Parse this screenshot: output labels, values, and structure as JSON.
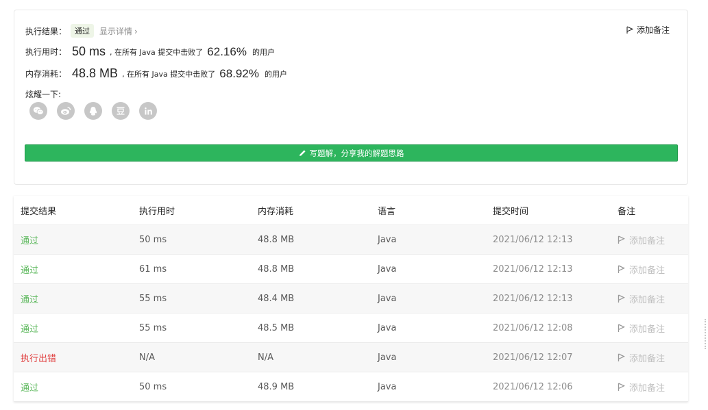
{
  "result": {
    "label_status": "执行结果：",
    "status": "通过",
    "details_link": "显示详情",
    "add_note": "添加备注",
    "runtime": {
      "label": "执行用时：",
      "value": "50 ms",
      "prefix": ", 在所有 Java 提交中击败了",
      "percent": "62.16%",
      "suffix": "的用户"
    },
    "memory": {
      "label": "内存消耗：",
      "value": "48.8 MB",
      "prefix": ", 在所有 Java 提交中击败了",
      "percent": "68.92%",
      "suffix": "的用户"
    },
    "share_label": "炫耀一下:",
    "share_icons": [
      "wechat-icon",
      "weibo-icon",
      "qq-icon",
      "douban-icon",
      "linkedin-icon"
    ],
    "write_solution": "写题解，分享我的解题思路"
  },
  "table": {
    "headers": [
      "提交结果",
      "执行用时",
      "内存消耗",
      "语言",
      "提交时间",
      "备注"
    ],
    "rows": [
      {
        "status": "通过",
        "ok": true,
        "time": "50 ms",
        "memory": "48.8 MB",
        "lang": "Java",
        "submitted": "2021/06/12 12:13",
        "note": "添加备注"
      },
      {
        "status": "通过",
        "ok": true,
        "time": "61 ms",
        "memory": "48.8 MB",
        "lang": "Java",
        "submitted": "2021/06/12 12:13",
        "note": "添加备注"
      },
      {
        "status": "通过",
        "ok": true,
        "time": "55 ms",
        "memory": "48.4 MB",
        "lang": "Java",
        "submitted": "2021/06/12 12:13",
        "note": "添加备注"
      },
      {
        "status": "通过",
        "ok": true,
        "time": "55 ms",
        "memory": "48.5 MB",
        "lang": "Java",
        "submitted": "2021/06/12 12:08",
        "note": "添加备注"
      },
      {
        "status": "执行出错",
        "ok": false,
        "time": "N/A",
        "memory": "N/A",
        "lang": "Java",
        "submitted": "2021/06/12 12:07",
        "note": "添加备注"
      },
      {
        "status": "通过",
        "ok": true,
        "time": "50 ms",
        "memory": "48.9 MB",
        "lang": "Java",
        "submitted": "2021/06/12 12:06",
        "note": "添加备注"
      }
    ]
  },
  "colors": {
    "accept": "#5cb85c",
    "error": "#e03e3e",
    "primary_button": "#2db55d"
  }
}
